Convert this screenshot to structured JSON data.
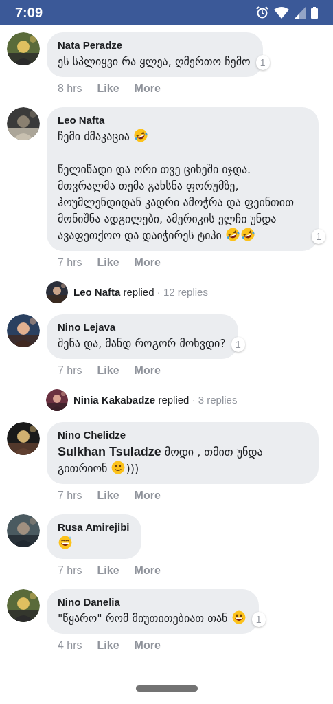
{
  "status_bar": {
    "time": "7:09"
  },
  "feed": [
    {
      "kind": "comment",
      "author": "Nata Peradze",
      "message": [
        {
          "kind": "text",
          "text": "ეს სპლიყვი რა ყლეა, ღმერთო ჩემო"
        }
      ],
      "reaction_count": "1",
      "time": "8 hrs",
      "like": "Like",
      "more": "More"
    },
    {
      "kind": "comment",
      "author": "Leo Nafta",
      "message": [
        {
          "kind": "text",
          "text": "ჩემი ძმაკაცია "
        },
        {
          "kind": "laughing"
        },
        {
          "kind": "text",
          "text": "\n\nწელიწადი და ორი თვე ციხეში იჯდა. მთვრალმა თემა გახსნა ფორუმზე, ჰოუმლენდიდან კადრი ამოჭრა და ფეინთით მონიშნა ადგილები, ამერიკის ელჩი უნდა ავაფეთქოო და დაიჭირეს ტიპი "
        },
        {
          "kind": "laughing"
        },
        {
          "kind": "laughing"
        }
      ],
      "reaction_count": "1",
      "time": "7 hrs",
      "like": "Like",
      "more": "More"
    },
    {
      "kind": "replies",
      "author": "Leo Nafta",
      "action": "replied",
      "count": "· 12 replies"
    },
    {
      "kind": "comment",
      "author": "Nino Lejava",
      "message": [
        {
          "kind": "text",
          "text": "შენა და, მანდ როგორ მოხვდი?"
        }
      ],
      "reaction_count": "1",
      "time": "7 hrs",
      "like": "Like",
      "more": "More"
    },
    {
      "kind": "replies",
      "author": "Ninia Kakabadze",
      "action": "replied",
      "count": "· 3 replies"
    },
    {
      "kind": "comment",
      "author": "Nino Chelidze",
      "message": [
        {
          "kind": "mention",
          "text": "Sulkhan Tsuladze"
        },
        {
          "kind": "text",
          "text": " მოდი , თმით უნდა გითრიონ "
        },
        {
          "kind": "smiling"
        },
        {
          "kind": "text",
          "text": ")))"
        }
      ],
      "time": "7 hrs",
      "like": "Like",
      "more": "More"
    },
    {
      "kind": "comment",
      "author": "Rusa Amirejibi",
      "message": [
        {
          "kind": "sweating"
        }
      ],
      "time": "7 hrs",
      "like": "Like",
      "more": "More"
    },
    {
      "kind": "comment",
      "author": "Nino Danelia",
      "message": [
        {
          "kind": "text",
          "text": "\"წყარო\" რომ მიუთითებიათ თან "
        },
        {
          "kind": "grinning"
        }
      ],
      "reaction_count": "1",
      "time": "4 hrs",
      "like": "Like",
      "more": "More"
    }
  ]
}
